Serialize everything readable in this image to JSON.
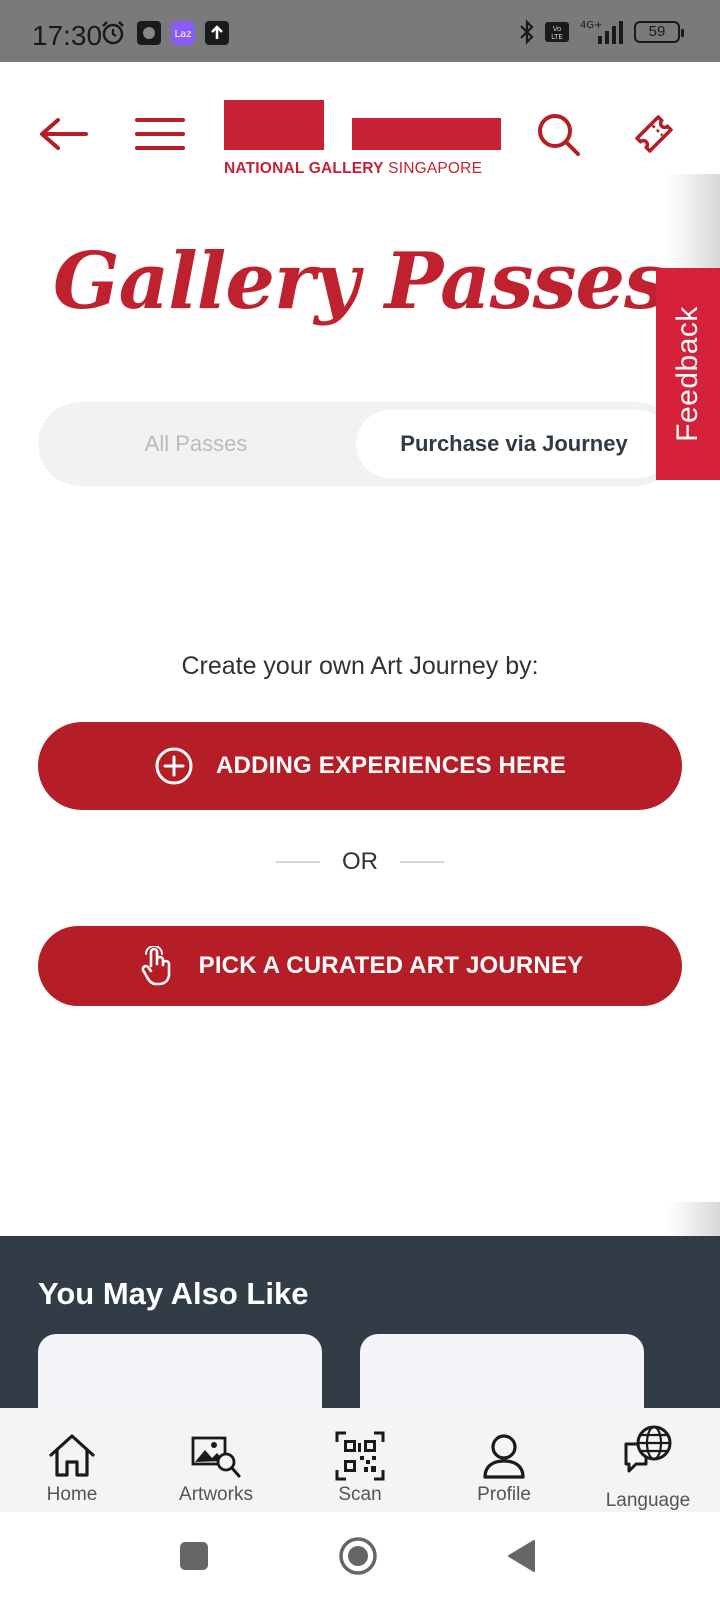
{
  "status_bar": {
    "time": "17:30",
    "network": "4G+",
    "volte": "Vo LTE",
    "battery": "59"
  },
  "header": {
    "logo_bold": "NATIONAL GALLERY",
    "logo_light": "SINGAPORE",
    "icons": [
      "back-arrow-icon",
      "menu-icon",
      "search-icon",
      "ticket-icon"
    ]
  },
  "page": {
    "title": "Gallery Passes",
    "tabs": [
      {
        "label": "All Passes",
        "active": false
      },
      {
        "label": "Purchase via Journey",
        "active": true
      }
    ],
    "feedback_label": "Feedback",
    "lead_text": "Create your own Art Journey by:",
    "add_button_label": "ADDING EXPERIENCES HERE",
    "or_label": "OR",
    "pick_button_label": "PICK A CURATED ART JOURNEY"
  },
  "also_like": {
    "title": "You May Also Like"
  },
  "bottom_nav": {
    "items": [
      {
        "label": "Home",
        "icon": "home-icon"
      },
      {
        "label": "Artworks",
        "icon": "artworks-icon"
      },
      {
        "label": "Scan",
        "icon": "qr-scan-icon"
      },
      {
        "label": "Profile",
        "icon": "profile-icon"
      },
      {
        "label": "Language",
        "icon": "language-icon"
      }
    ]
  },
  "colors": {
    "brand_red": "#c82034",
    "button_red": "#b51d27",
    "dark_section": "#313c46"
  }
}
